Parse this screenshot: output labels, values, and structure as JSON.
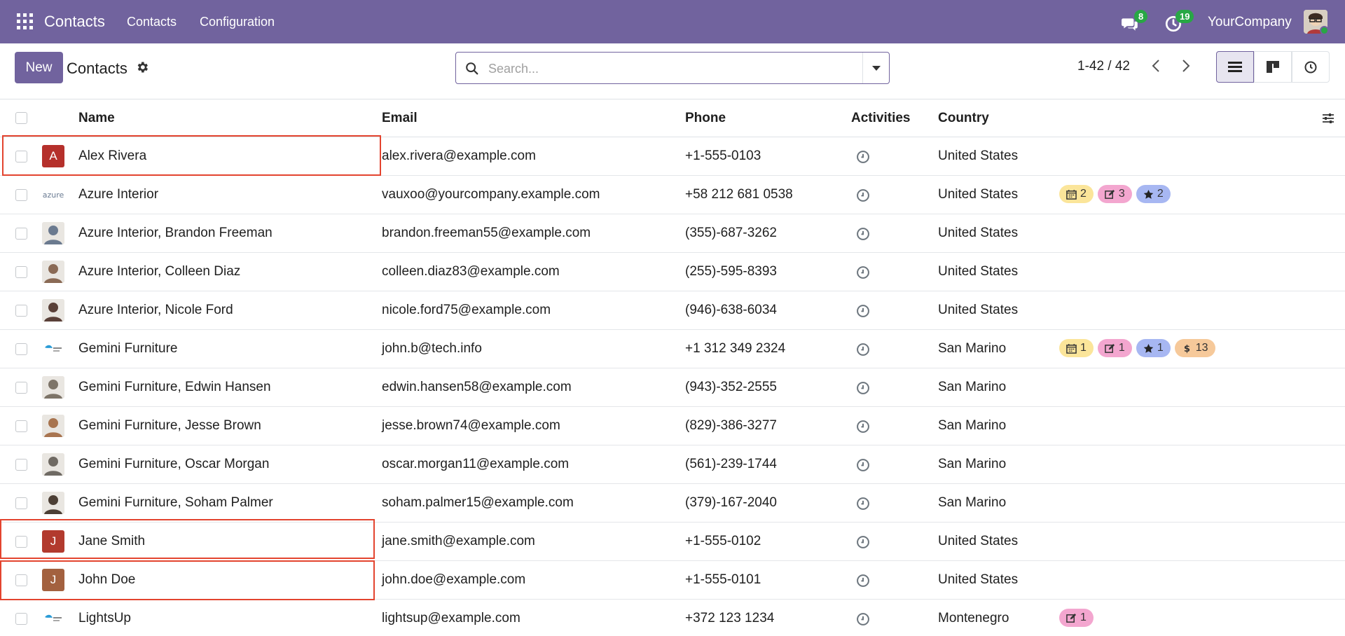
{
  "navbar": {
    "app_name": "Contacts",
    "menu": [
      "Contacts",
      "Configuration"
    ],
    "messages_count": "8",
    "activities_count": "19",
    "company": "YourCompany"
  },
  "control": {
    "new_label": "New",
    "title": "Contacts",
    "search_placeholder": "Search...",
    "pager": "1-42 / 42"
  },
  "table": {
    "headers": {
      "name": "Name",
      "email": "Email",
      "phone": "Phone",
      "activities": "Activities",
      "country": "Country"
    },
    "rows": [
      {
        "avatar": "A",
        "avatar_color": "#b5302b",
        "name": "Alex Rivera",
        "email": "alex.rivera@example.com",
        "phone": "+1-555-0103",
        "country": "United States",
        "tags": []
      },
      {
        "avatar": "azure",
        "avatar_color": "#ffffff",
        "name": "Azure Interior",
        "email": "vauxoo@yourcompany.example.com",
        "phone": "+58 212 681 0538",
        "country": "United States",
        "tags": [
          {
            "icon": "calendar-icon",
            "count": "2",
            "color": "yellow"
          },
          {
            "icon": "edit-icon",
            "count": "3",
            "color": "pink"
          },
          {
            "icon": "star-icon",
            "count": "2",
            "color": "blue"
          }
        ]
      },
      {
        "avatar": "",
        "avatar_color": "#6b7a8f",
        "name": "Azure Interior, Brandon Freeman",
        "email": "brandon.freeman55@example.com",
        "phone": "(355)-687-3262",
        "country": "United States",
        "tags": []
      },
      {
        "avatar": "",
        "avatar_color": "#8a6a55",
        "name": "Azure Interior, Colleen Diaz",
        "email": "colleen.diaz83@example.com",
        "phone": "(255)-595-8393",
        "country": "United States",
        "tags": []
      },
      {
        "avatar": "",
        "avatar_color": "#5a4038",
        "name": "Azure Interior, Nicole Ford",
        "email": "nicole.ford75@example.com",
        "phone": "(946)-638-6034",
        "country": "United States",
        "tags": []
      },
      {
        "avatar": "",
        "avatar_color": "#ffffff",
        "name": "Gemini Furniture",
        "email": "john.b@tech.info",
        "phone": "+1 312 349 2324",
        "country": "San Marino",
        "tags": [
          {
            "icon": "calendar-icon",
            "count": "1",
            "color": "yellow"
          },
          {
            "icon": "edit-icon",
            "count": "1",
            "color": "pink"
          },
          {
            "icon": "star-icon",
            "count": "1",
            "color": "blue"
          },
          {
            "icon": "dollar-icon",
            "count": "13",
            "color": "orange"
          }
        ]
      },
      {
        "avatar": "",
        "avatar_color": "#7d7468",
        "name": "Gemini Furniture, Edwin Hansen",
        "email": "edwin.hansen58@example.com",
        "phone": "(943)-352-2555",
        "country": "San Marino",
        "tags": []
      },
      {
        "avatar": "",
        "avatar_color": "#a8744f",
        "name": "Gemini Furniture, Jesse Brown",
        "email": "jesse.brown74@example.com",
        "phone": "(829)-386-3277",
        "country": "San Marino",
        "tags": []
      },
      {
        "avatar": "",
        "avatar_color": "#6f6a63",
        "name": "Gemini Furniture, Oscar Morgan",
        "email": "oscar.morgan11@example.com",
        "phone": "(561)-239-1744",
        "country": "San Marino",
        "tags": []
      },
      {
        "avatar": "",
        "avatar_color": "#4c3f35",
        "name": "Gemini Furniture, Soham Palmer",
        "email": "soham.palmer15@example.com",
        "phone": "(379)-167-2040",
        "country": "San Marino",
        "tags": []
      },
      {
        "avatar": "J",
        "avatar_color": "#b23a2e",
        "name": "Jane Smith",
        "email": "jane.smith@example.com",
        "phone": "+1-555-0102",
        "country": "United States",
        "tags": []
      },
      {
        "avatar": "J",
        "avatar_color": "#a3613f",
        "name": "John Doe",
        "email": "john.doe@example.com",
        "phone": "+1-555-0101",
        "country": "United States",
        "tags": []
      },
      {
        "avatar": "",
        "avatar_color": "#ffffff",
        "name": "LightsUp",
        "email": "lightsup@example.com",
        "phone": "+372 123 1234",
        "country": "Montenegro",
        "tags": [
          {
            "icon": "edit-icon",
            "count": "1",
            "color": "pink"
          }
        ]
      }
    ]
  },
  "colors": {
    "brand": "#71639e",
    "highlight": "#e3442f",
    "badge": "#28a745"
  }
}
